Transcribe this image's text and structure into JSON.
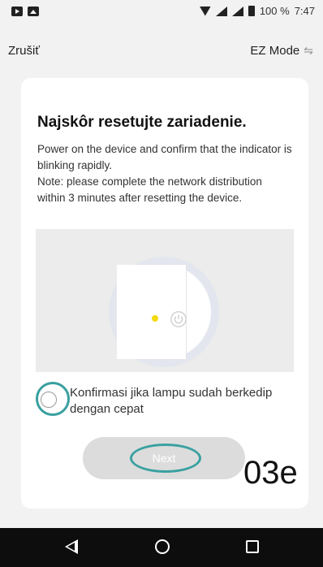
{
  "status_bar": {
    "battery_pct": "100 %",
    "time": "7:47",
    "left_icons": [
      "play-store-icon",
      "image-icon"
    ],
    "right_icons": [
      "wifi-icon",
      "signal-icon",
      "signal-icon",
      "battery-icon"
    ]
  },
  "top_bar": {
    "cancel_label": "Zrušiť",
    "mode_label": "EZ Mode",
    "mode_icon": "⇋"
  },
  "card": {
    "title": "Najskôr resetujte zariadenie.",
    "description": "Power on the device and confirm that the indicator is blinking rapidly.\nNote: please complete the network distribution within 3 minutes after resetting the device.",
    "illustration": {
      "led_color": "#f5d90a",
      "icon": "power-icon"
    },
    "confirm": {
      "label": "Konfirmasi jika lampu sudah berkedip dengan cepat",
      "checked": false
    },
    "next_label": "Next"
  },
  "watermark": "03e",
  "colors": {
    "annotation": "#3aa0a0",
    "button_disabled": "#dcdcdc"
  },
  "nav_bar": {
    "buttons": [
      "back-icon",
      "home-icon",
      "recent-apps-icon"
    ]
  }
}
